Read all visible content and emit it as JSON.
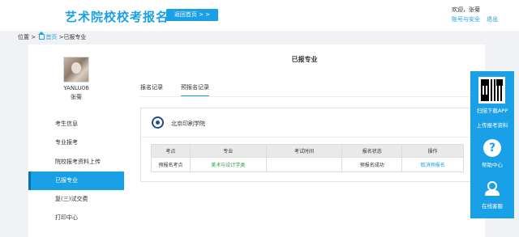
{
  "header": {
    "site_title": "艺术院校校考报名",
    "back_home": "返回首页 > >",
    "welcome": "欢迎，张菊",
    "account_security": "账号与安全",
    "logout": "退出"
  },
  "breadcrumb": {
    "location": "位置 >",
    "home": "首页",
    "separator": ">",
    "current": "已报专业"
  },
  "sidebar": {
    "username": "YANLU06",
    "realname": "张菊",
    "items": [
      {
        "label": "考生信息"
      },
      {
        "label": "专业报考"
      },
      {
        "label": "院校报考资料上传"
      },
      {
        "label": "已报专业"
      },
      {
        "label": "复(三)试交费"
      },
      {
        "label": "打印中心"
      }
    ]
  },
  "main": {
    "title": "已报专业",
    "tabs": [
      {
        "label": "报名记录"
      },
      {
        "label": "预报名记录"
      }
    ],
    "school_name": "北京印刷学院",
    "table": {
      "headers": [
        "考点",
        "专业",
        "考试时间",
        "报名状态",
        "操作"
      ],
      "rows": [
        {
          "site": "预报名考点",
          "major": "美术与设计学类",
          "time": "",
          "status": "预报名成功",
          "action": "取消预报名"
        }
      ]
    }
  },
  "float_panel": {
    "download_app": "扫描下载APP",
    "upload_materials": "上传报考资料",
    "help_center": "帮助中心",
    "online_support": "在线客服"
  },
  "colors": {
    "accent": "#1aa0e6",
    "major_text": "#2a9d3c"
  }
}
